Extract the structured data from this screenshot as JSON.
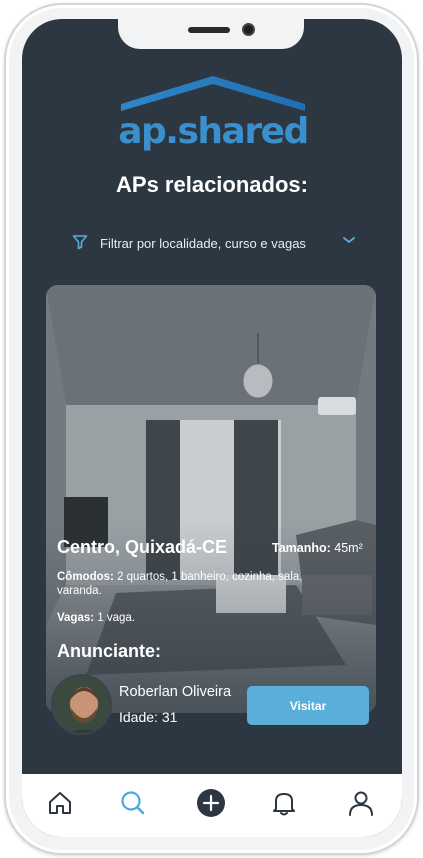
{
  "app": {
    "logo_text": "ap.shared",
    "page_title": "APs relacionados:"
  },
  "filter": {
    "label": "Filtrar por localidade, curso e vagas",
    "icon": "filter-icon",
    "chevron": "chevron-down-icon"
  },
  "listing": {
    "location": "Centro, Quixadá-CE",
    "size_label": "Tamanho:",
    "size_value": "45m²",
    "rooms_label": "Cômodos:",
    "rooms_value": "2 quartos, 1 banheiro, cozinha, sala, varanda.",
    "spots_label": "Vagas:",
    "spots_value": "1 vaga.",
    "advertiser_heading": "Anunciante:",
    "advertiser_name": "Roberlan Oliveira",
    "advertiser_age": "Idade: 31",
    "visit_button": "Visitar"
  },
  "tab_bar": {
    "items": [
      {
        "name": "home",
        "icon": "home-icon",
        "active": false
      },
      {
        "name": "search",
        "icon": "search-icon",
        "active": true
      },
      {
        "name": "add",
        "icon": "plus-circle-icon",
        "active": false
      },
      {
        "name": "notifications",
        "icon": "bell-icon",
        "active": false
      },
      {
        "name": "profile",
        "icon": "user-icon",
        "active": false
      }
    ]
  },
  "colors": {
    "background": "#2d3742",
    "accent": "#3a8fcd",
    "button": "#5baed9",
    "active_tab": "#4aa8e0",
    "tab_icon": "#2d3742"
  }
}
